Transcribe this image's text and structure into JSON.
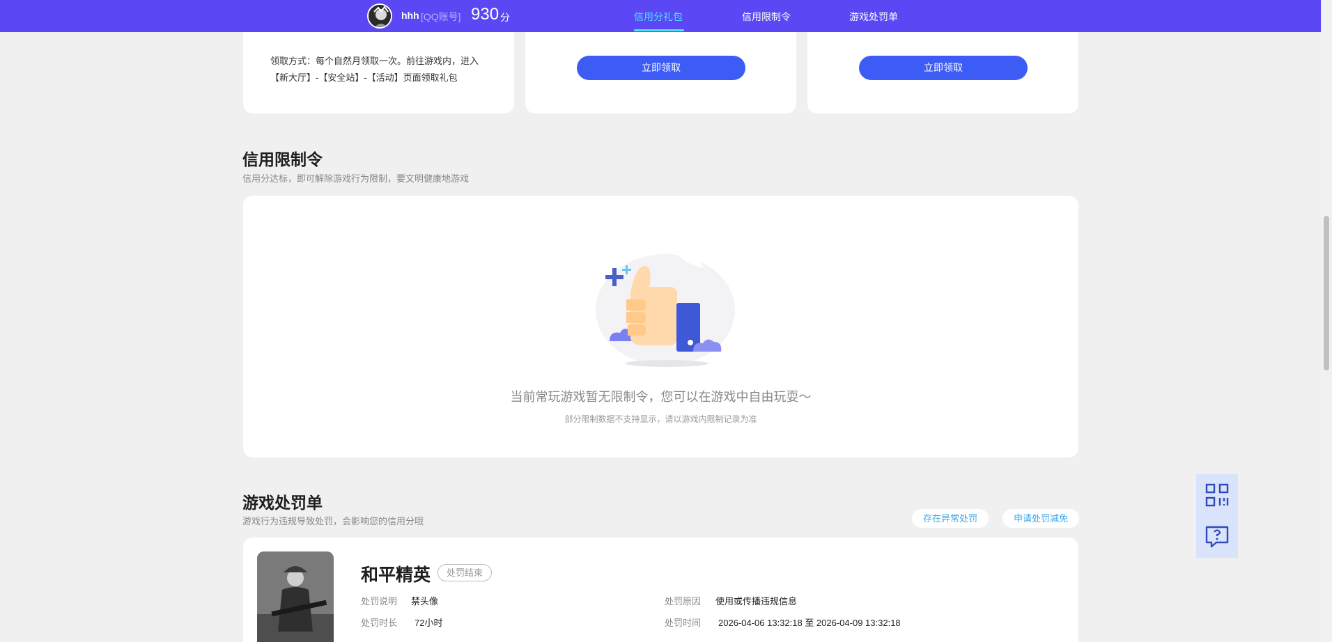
{
  "header": {
    "user_name": "hhh",
    "account_type": "[QQ账号]",
    "score": "930",
    "score_unit": "分",
    "tabs": [
      {
        "label": "信用分礼包",
        "active": true
      },
      {
        "label": "信用限制令",
        "active": false
      },
      {
        "label": "游戏处罚单",
        "active": false
      }
    ]
  },
  "gift": {
    "claim_text": "领取方式：每个自然月领取一次。前往游戏内，进入【新大厅】-【安全站】-【活动】页面领取礼包",
    "buttons": [
      "立即领取",
      "立即领取"
    ]
  },
  "restriction": {
    "title": "信用限制令",
    "subtitle": "信用分达标，即可解除游戏行为限制，要文明健康地游戏",
    "empty_message": "当前常玩游戏暂无限制令，您可以在游戏中自由玩耍～",
    "empty_note": "部分限制数据不支持显示，请以游戏内限制记录为准"
  },
  "punishment": {
    "title": "游戏处罚单",
    "subtitle": "游戏行为违规导致处罚，会影响您的信用分哦",
    "report_button": "存在异常处罚",
    "appeal_button": "申请处罚减免",
    "game_name": "和平精英",
    "status": "处罚结束",
    "desc_label": "处罚说明",
    "desc_value": "禁头像",
    "reason_label": "处罚原因",
    "reason_value": "使用或传播违规信息",
    "duration_label": "处罚时长",
    "duration_value": "72小时",
    "time_label": "处罚时间",
    "time_value": "2026-04-06 13:32:18 至 2026-04-09 13:32:18"
  },
  "icons": {
    "qr": "qr-code-icon",
    "help": "help-chat-icon",
    "thumb": "thumbs-up-illustration"
  },
  "colors": {
    "nav_bg": "#5b47f3",
    "active_tab": "#4ee0ff",
    "primary_button": "#3d5cf5",
    "page_bg": "#f0f0f0"
  }
}
